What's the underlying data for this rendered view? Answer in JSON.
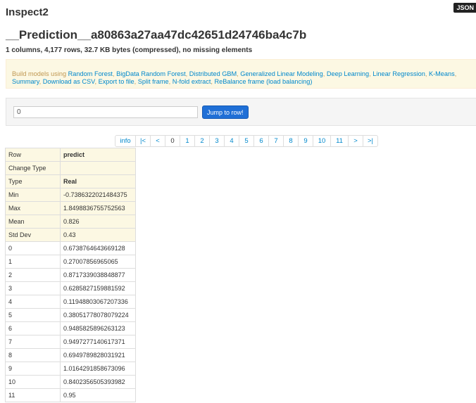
{
  "json_button": "JSON",
  "title": "Inspect2",
  "key": "__Prediction__a80863a27aa47dc42651d24746ba4c7b",
  "summary": "1 columns, 4,177 rows, 32.7 KB bytes (compressed), no missing elements",
  "alert": {
    "prefix": "Build models using ",
    "links": [
      "Random Forest",
      "BigData Random Forest",
      "Distributed GBM",
      "Generalized Linear Modeling",
      "Deep Learning",
      "Linear Regression",
      "K-Means",
      "Summary",
      "Download as CSV",
      "Export to file",
      "Split frame",
      "N-fold extract",
      "ReBalance frame (load balancing)"
    ]
  },
  "jump": {
    "value": "0",
    "button": "Jump to row!"
  },
  "pager": [
    "info",
    "|<",
    "<",
    "0",
    "1",
    "2",
    "3",
    "4",
    "5",
    "6",
    "7",
    "8",
    "9",
    "10",
    "11",
    ">",
    ">|"
  ],
  "pager_active": "0",
  "table": {
    "header_rows": [
      [
        "Row",
        "predict"
      ],
      [
        "Change Type",
        ""
      ],
      [
        "Type",
        "Real"
      ],
      [
        "Min",
        "-0.7386322021484375"
      ],
      [
        "Max",
        "1.8498836755752563"
      ],
      [
        "Mean",
        "0.826"
      ],
      [
        "Std Dev",
        "0.43"
      ]
    ],
    "rows": [
      [
        "0",
        "0.6738764643669128"
      ],
      [
        "1",
        "0.27007856965065"
      ],
      [
        "2",
        "0.8717339038848877"
      ],
      [
        "3",
        "0.6285827159881592"
      ],
      [
        "4",
        "0.11948803067207336"
      ],
      [
        "5",
        "0.38051778078079224"
      ],
      [
        "6",
        "0.9485825896263123"
      ],
      [
        "7",
        "0.9497277140617371"
      ],
      [
        "8",
        "0.6949789828031921"
      ],
      [
        "9",
        "1.0164291858673096"
      ],
      [
        "10",
        "0.8402356505393982"
      ],
      [
        "11",
        "0.95"
      ]
    ]
  }
}
